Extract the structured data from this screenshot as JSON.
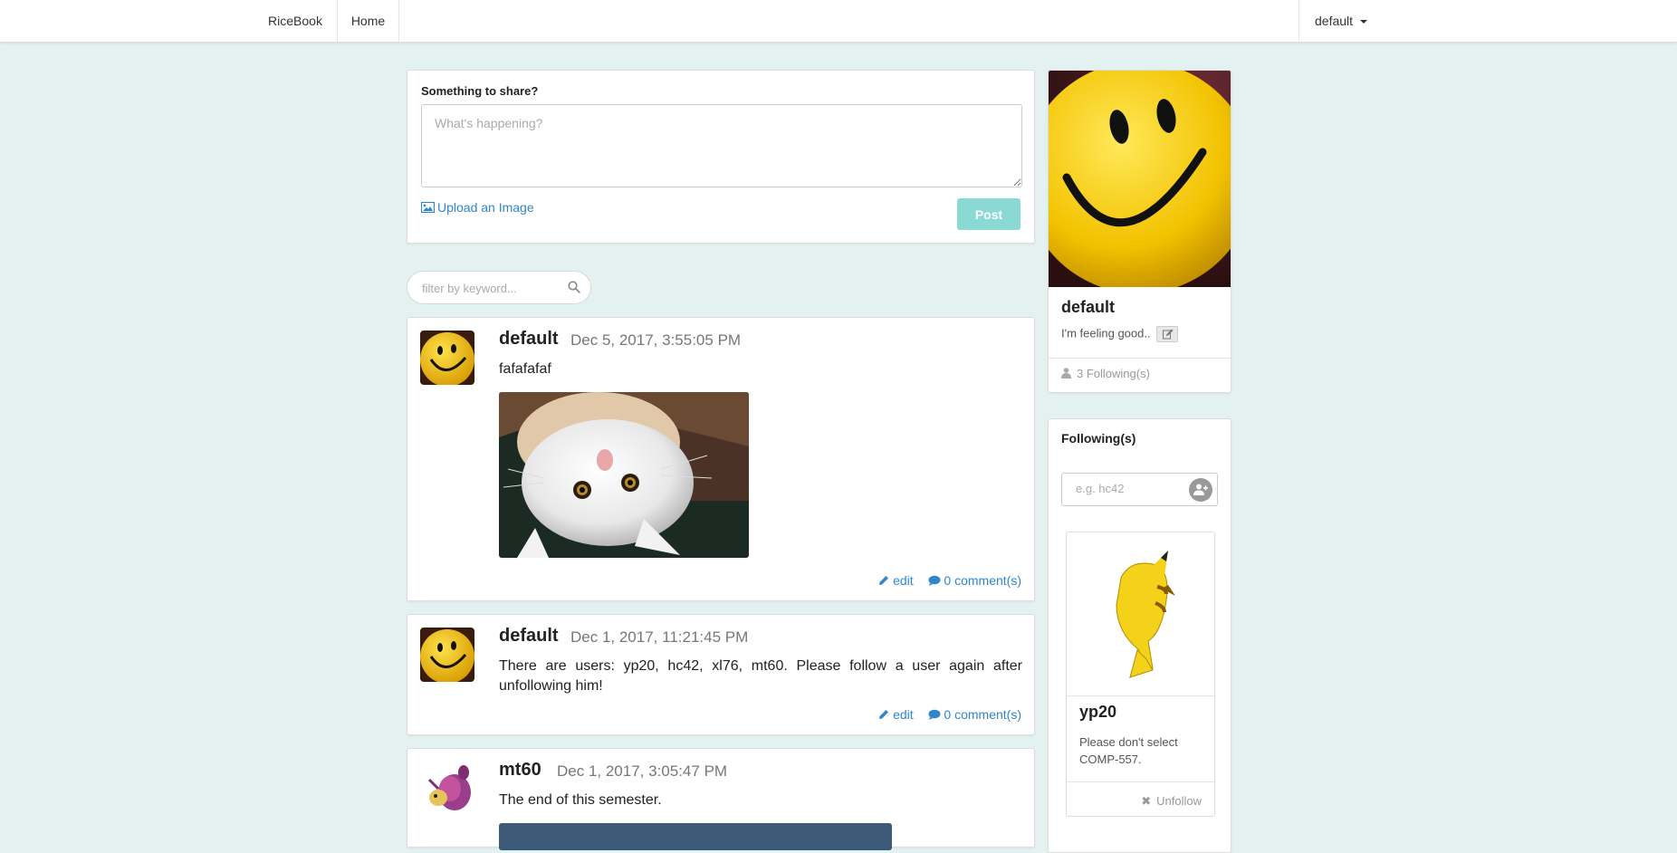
{
  "nav": {
    "brand": "RiceBook",
    "home": "Home",
    "user": "default"
  },
  "share": {
    "label": "Something to share?",
    "placeholder": "What's happening?",
    "upload_label": "Upload an Image",
    "post_label": "Post"
  },
  "filter": {
    "placeholder": "filter by keyword..."
  },
  "posts": [
    {
      "author": "default",
      "date": "Dec 5, 2017, 3:55:05 PM",
      "text": "fafafafaf",
      "edit_label": "edit",
      "comments_label": "0 comment(s)"
    },
    {
      "author": "default",
      "date": "Dec 1, 2017, 11:21:45 PM",
      "text": "There are users: yp20, hc42, xl76, mt60. Please follow a user again after unfollowing him!",
      "edit_label": "edit",
      "comments_label": "0 comment(s)"
    },
    {
      "author": "mt60",
      "date": "Dec 1, 2017, 3:05:47 PM",
      "text": "The end of this semester."
    }
  ],
  "profile": {
    "name": "default",
    "status": "I'm feeling good..",
    "following_count": "3 Following(s)"
  },
  "following": {
    "title": "Following(s)",
    "input_placeholder": "e.g. hc42",
    "friends": [
      {
        "name": "yp20",
        "status": "Please don't select COMP-557.",
        "unfollow_label": "Unfollow"
      }
    ]
  },
  "colors": {
    "background": "#e4f1f1",
    "accent_link": "#2f86c9",
    "post_button": "#8ad9d5"
  }
}
